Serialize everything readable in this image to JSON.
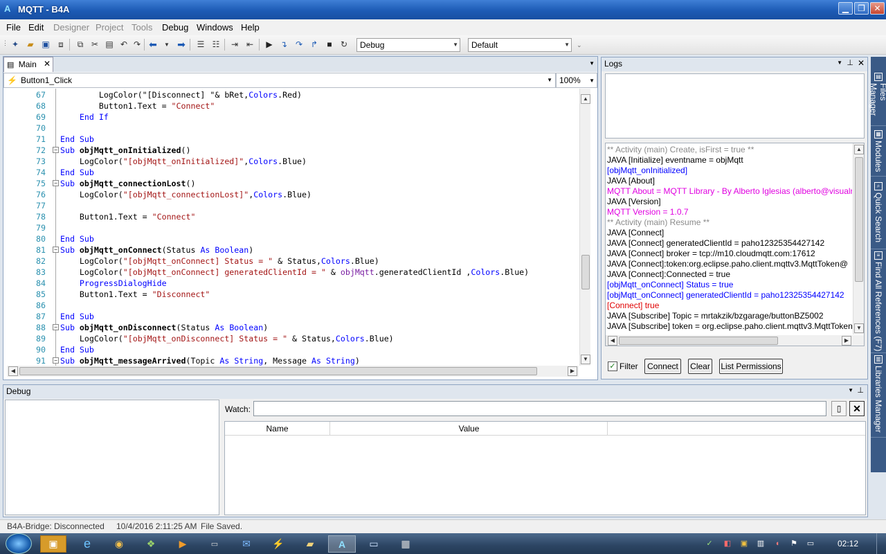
{
  "window": {
    "title": "MQTT - B4A",
    "min": "▁",
    "max": "❐",
    "close": "✕"
  },
  "menu": [
    {
      "label": "File",
      "enabled": true
    },
    {
      "label": "Edit",
      "enabled": true
    },
    {
      "label": "Designer",
      "enabled": false
    },
    {
      "label": "Project",
      "enabled": false
    },
    {
      "label": "Tools",
      "enabled": false
    },
    {
      "label": "Debug",
      "enabled": true
    },
    {
      "label": "Windows",
      "enabled": true
    },
    {
      "label": "Help",
      "enabled": true
    }
  ],
  "toolbar": {
    "build_config": "Debug",
    "device": "Default"
  },
  "editor": {
    "tab_label": "Main",
    "sub_combo": "Button1_Click",
    "zoom": "100%",
    "lines": [
      {
        "n": "67",
        "segs": [
          [
            "        ",
            ""
          ],
          [
            "LogColor",
            "fn"
          ],
          [
            "(\"[Disconnect] \"& bRet,",
            ""
          ],
          [
            "Colors",
            "ty"
          ],
          [
            ".Red)",
            ""
          ]
        ]
      },
      {
        "n": "68",
        "segs": [
          [
            "        Button1.Text = ",
            ""
          ],
          [
            "\"Connect\"",
            "str"
          ]
        ]
      },
      {
        "n": "69",
        "segs": [
          [
            "    ",
            ""
          ],
          [
            "End If",
            "kw"
          ]
        ]
      },
      {
        "n": "70",
        "segs": [
          [
            "",
            ""
          ]
        ]
      },
      {
        "n": "71",
        "segs": [
          [
            "",
            ""
          ],
          [
            "End Sub",
            "kw"
          ]
        ]
      },
      {
        "n": "72",
        "fold": true,
        "segs": [
          [
            "Sub ",
            "kw"
          ],
          [
            "objMqtt_onInitialized",
            "bold"
          ],
          [
            "()",
            ""
          ]
        ]
      },
      {
        "n": "73",
        "segs": [
          [
            "    LogColor(",
            ""
          ],
          [
            "\"[objMqtt_onInitialized]\"",
            "str"
          ],
          [
            ",",
            ""
          ],
          [
            "Colors",
            "ty"
          ],
          [
            ".Blue)",
            ""
          ]
        ]
      },
      {
        "n": "74",
        "segs": [
          [
            "",
            ""
          ],
          [
            "End Sub",
            "kw"
          ]
        ]
      },
      {
        "n": "75",
        "fold": true,
        "segs": [
          [
            "Sub ",
            "kw"
          ],
          [
            "objMqtt_connectionLost",
            "bold"
          ],
          [
            "()",
            ""
          ]
        ]
      },
      {
        "n": "76",
        "segs": [
          [
            "    LogColor(",
            ""
          ],
          [
            "\"[objMqtt_connectionLost]\"",
            "str"
          ],
          [
            ",",
            ""
          ],
          [
            "Colors",
            "ty"
          ],
          [
            ".Blue)",
            ""
          ]
        ]
      },
      {
        "n": "77",
        "segs": [
          [
            "",
            ""
          ]
        ]
      },
      {
        "n": "78",
        "segs": [
          [
            "    Button1.Text = ",
            ""
          ],
          [
            "\"Connect\"",
            "str"
          ]
        ]
      },
      {
        "n": "79",
        "segs": [
          [
            "",
            ""
          ]
        ]
      },
      {
        "n": "80",
        "segs": [
          [
            "",
            ""
          ],
          [
            "End Sub",
            "kw"
          ]
        ]
      },
      {
        "n": "81",
        "fold": true,
        "segs": [
          [
            "Sub ",
            "kw"
          ],
          [
            "objMqtt_onConnect",
            "bold"
          ],
          [
            "(Status ",
            ""
          ],
          [
            "As ",
            "kw"
          ],
          [
            "Boolean",
            "ty"
          ],
          [
            ")",
            ""
          ]
        ]
      },
      {
        "n": "82",
        "segs": [
          [
            "    LogColor(",
            ""
          ],
          [
            "\"[objMqtt_onConnect] Status = \"",
            "str"
          ],
          [
            " & Status,",
            ""
          ],
          [
            "Colors",
            "ty"
          ],
          [
            ".Blue)",
            ""
          ]
        ]
      },
      {
        "n": "83",
        "segs": [
          [
            "    LogColor(",
            ""
          ],
          [
            "\"[objMqtt_onConnect] generatedClientId = \"",
            "str"
          ],
          [
            " & ",
            ""
          ],
          [
            "objMqtt",
            "pu"
          ],
          [
            ".generatedClientId ,",
            ""
          ],
          [
            "Colors",
            "ty"
          ],
          [
            ".Blue)",
            ""
          ]
        ]
      },
      {
        "n": "84",
        "segs": [
          [
            "    ",
            ""
          ],
          [
            "ProgressDialogHide",
            "ty"
          ]
        ]
      },
      {
        "n": "85",
        "segs": [
          [
            "    Button1.Text = ",
            ""
          ],
          [
            "\"Disconnect\"",
            "str"
          ]
        ]
      },
      {
        "n": "86",
        "segs": [
          [
            "",
            ""
          ]
        ]
      },
      {
        "n": "87",
        "segs": [
          [
            "",
            ""
          ],
          [
            "End Sub",
            "kw"
          ]
        ]
      },
      {
        "n": "88",
        "fold": true,
        "segs": [
          [
            "Sub ",
            "kw"
          ],
          [
            "objMqtt_onDisconnect",
            "bold"
          ],
          [
            "(Status ",
            ""
          ],
          [
            "As ",
            "kw"
          ],
          [
            "Boolean",
            "ty"
          ],
          [
            ")",
            ""
          ]
        ]
      },
      {
        "n": "89",
        "segs": [
          [
            "    LogColor(",
            ""
          ],
          [
            "\"[objMqtt_onDisconnect] Status = \"",
            "str"
          ],
          [
            " & Status,",
            ""
          ],
          [
            "Colors",
            "ty"
          ],
          [
            ".Blue)",
            ""
          ]
        ]
      },
      {
        "n": "90",
        "segs": [
          [
            "",
            ""
          ],
          [
            "End Sub",
            "kw"
          ]
        ]
      },
      {
        "n": "91",
        "fold": true,
        "segs": [
          [
            "Sub ",
            "kw"
          ],
          [
            "objMqtt_messageArrived",
            "bold"
          ],
          [
            "(Topic ",
            ""
          ],
          [
            "As ",
            "kw"
          ],
          [
            "String",
            "ty"
          ],
          [
            ", Message ",
            ""
          ],
          [
            "As ",
            "kw"
          ],
          [
            "String",
            "ty"
          ],
          [
            ")",
            ""
          ]
        ]
      }
    ]
  },
  "logs": {
    "title": "Logs",
    "entries": [
      {
        "text": "** Activity (main) Create, isFirst = true **",
        "color": "#8a8a8a"
      },
      {
        "text": "JAVA [Initialize] eventname = objMqtt",
        "color": "#000000"
      },
      {
        "text": "[objMqtt_onInitialized]",
        "color": "#0000ff"
      },
      {
        "text": "JAVA [About]",
        "color": "#000000"
      },
      {
        "text": "MQTT About = MQTT Library - By Alberto Iglesias (alberto@visualr",
        "color": "#e000e0"
      },
      {
        "text": "JAVA [Version]",
        "color": "#000000"
      },
      {
        "text": "MQTT Version = 1.0.7",
        "color": "#e000e0"
      },
      {
        "text": "** Activity (main) Resume **",
        "color": "#8a8a8a"
      },
      {
        "text": "JAVA [Connect]",
        "color": "#000000"
      },
      {
        "text": "JAVA [Connect] generatedClientId = paho12325354427142",
        "color": "#000000"
      },
      {
        "text": "JAVA [Connect] broker = tcp://m10.cloudmqtt.com:17612",
        "color": "#000000"
      },
      {
        "text": "JAVA [Connect]:token:org.eclipse.paho.client.mqttv3.MqttToken@",
        "color": "#000000"
      },
      {
        "text": "JAVA [Connect]:Connected = true",
        "color": "#000000"
      },
      {
        "text": "[objMqtt_onConnect] Status = true",
        "color": "#0000ff"
      },
      {
        "text": "[objMqtt_onConnect] generatedClientId = paho12325354427142",
        "color": "#0000ff"
      },
      {
        "text": "[Connect] true",
        "color": "#e00000"
      },
      {
        "text": "JAVA [Subscribe] Topic = mrtakzik/bzgarage/buttonBZ5002",
        "color": "#000000"
      },
      {
        "text": "JAVA [Subscribe] token = org.eclipse.paho.client.mqttv3.MqttToken",
        "color": "#000000"
      }
    ],
    "filter_label": "Filter",
    "filter_checked": true,
    "buttons": {
      "connect": "Connect",
      "clear": "Clear",
      "permissions": "List Permissions"
    }
  },
  "debug": {
    "title": "Debug",
    "watch_label": "Watch:",
    "watch_value": "",
    "columns": [
      "Name",
      "Value"
    ]
  },
  "side_tabs": [
    {
      "label": "Files Manager",
      "icon": "▤"
    },
    {
      "label": "Modules",
      "icon": "▦"
    },
    {
      "label": "Quick Search",
      "icon": "⌕"
    },
    {
      "label": "Find All References (F7)",
      "icon": "≡"
    },
    {
      "label": "Libraries Manager",
      "icon": "▥"
    }
  ],
  "status": {
    "bridge": "B4A-Bridge: Disconnected",
    "time": "10/4/2016 2:11:25 AM",
    "message": "File Saved."
  },
  "taskbar": {
    "clock": "02:12"
  },
  "colors": {
    "keyword": "#0000ff",
    "string": "#a31515",
    "line_number": "#2b91af",
    "accent": "#1d5bb5"
  }
}
